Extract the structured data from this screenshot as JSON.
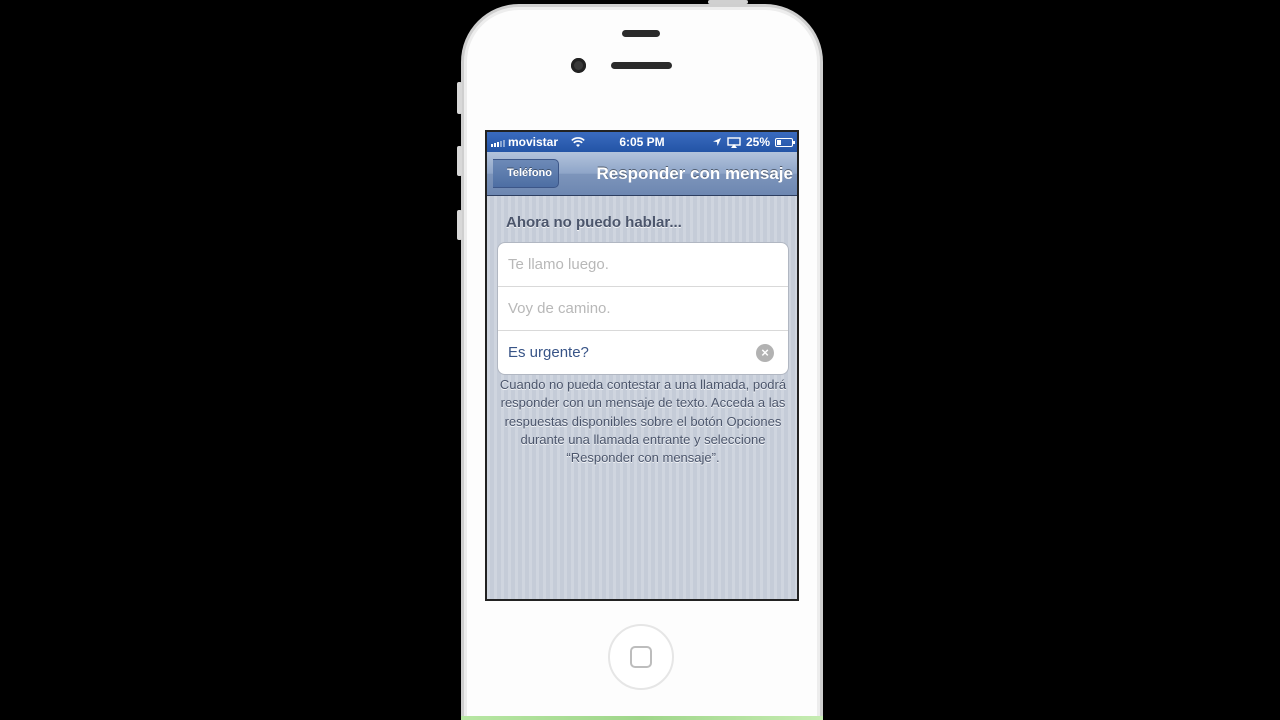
{
  "status_bar": {
    "carrier": "movistar",
    "time": "6:05 PM",
    "battery_percent": "25%",
    "battery_level": 0.25
  },
  "nav": {
    "back_label": "Teléfono",
    "title": "Responder con mensaje"
  },
  "section_header": "Ahora no puedo hablar...",
  "responses": [
    {
      "placeholder": "Te llamo luego.",
      "value": ""
    },
    {
      "placeholder": "Voy de camino.",
      "value": ""
    },
    {
      "placeholder": "",
      "value": "Es urgente?"
    }
  ],
  "clear_glyph": "×",
  "footer": "Cuando no pueda contestar a una llamada, podrá responder con un mensaje de texto. Acceda a las respuestas disponibles sobre el botón Opciones durante una llamada entrante y seleccione “Responder con mensaje”.",
  "colors": {
    "statusbar": "#2a5bae",
    "navbar": "#8ea5c8",
    "background": "#c5ccd8",
    "active_text": "#385487"
  }
}
